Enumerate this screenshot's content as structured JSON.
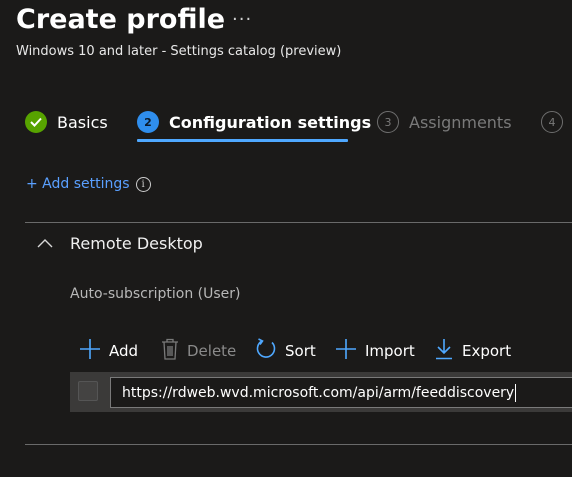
{
  "header": {
    "title": "Create profile",
    "more": "···",
    "subtitle": "Windows 10 and later - Settings catalog (preview)"
  },
  "steps": [
    {
      "number": "",
      "label": "Basics",
      "state": "completed"
    },
    {
      "number": "2",
      "label": "Configuration settings",
      "state": "active"
    },
    {
      "number": "3",
      "label": "Assignments",
      "state": "inactive"
    },
    {
      "number": "4",
      "label": "",
      "state": "inactive"
    }
  ],
  "add_settings": {
    "label": "+ Add settings",
    "info_icon": "i"
  },
  "section": {
    "title": "Remote Desktop",
    "setting_label": "Auto-subscription (User)"
  },
  "toolbar": {
    "add_label": "Add",
    "delete_label": "Delete",
    "sort_label": "Sort",
    "import_label": "Import",
    "export_label": "Export"
  },
  "entry": {
    "value": "https://rdweb.wvd.microsoft.com/api/arm/feeddiscovery"
  },
  "colors": {
    "accent": "#2f8eed",
    "link": "#5aa0ff",
    "success": "#57a300",
    "background": "#1b1a19"
  }
}
